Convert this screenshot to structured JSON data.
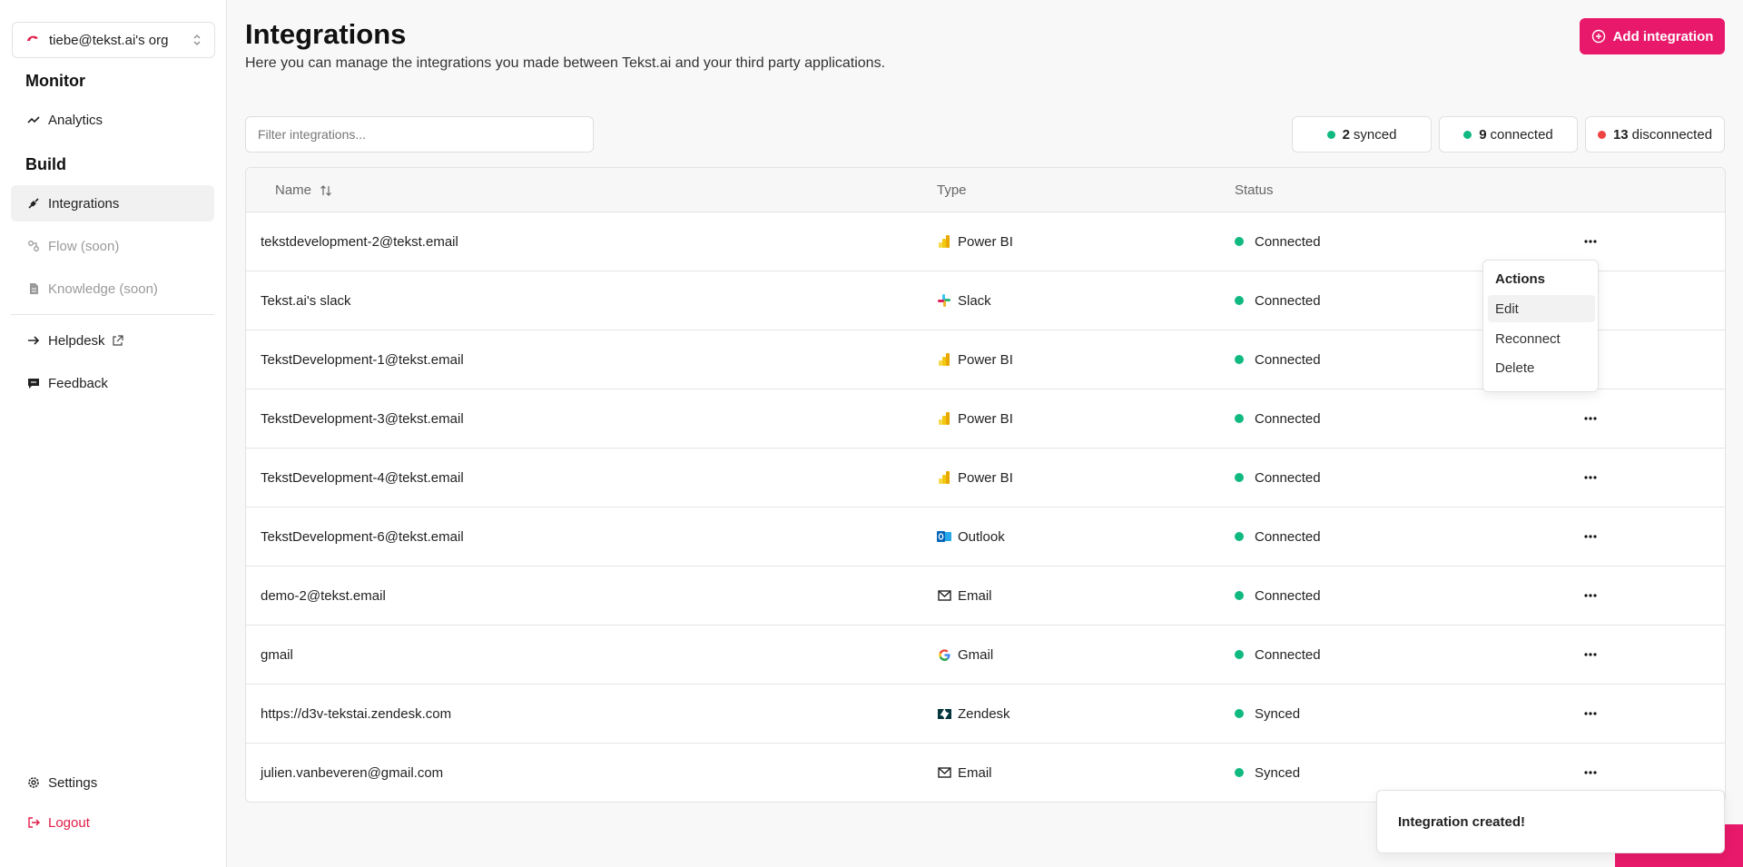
{
  "sidebar": {
    "org_label": "tiebe@tekst.ai's org",
    "sections": {
      "monitor": "Monitor",
      "build": "Build"
    },
    "items": {
      "analytics": "Analytics",
      "integrations": "Integrations",
      "flow": "Flow (soon)",
      "knowledge": "Knowledge (soon)",
      "helpdesk": "Helpdesk",
      "feedback": "Feedback",
      "settings": "Settings",
      "logout": "Logout"
    }
  },
  "header": {
    "title": "Integrations",
    "subtitle": "Here you can manage the integrations you made between Tekst.ai and your third party applications.",
    "add_label": "Add integration"
  },
  "filter": {
    "placeholder": "Filter integrations..."
  },
  "summary": {
    "synced": {
      "count": "2",
      "label": "synced"
    },
    "connected": {
      "count": "9",
      "label": "connected"
    },
    "disconnected": {
      "count": "13",
      "label": "disconnected"
    }
  },
  "table": {
    "headers": {
      "name": "Name",
      "type": "Type",
      "status": "Status"
    },
    "rows": [
      {
        "name": "tekstdevelopment-2@tekst.email",
        "type": "Power BI",
        "status": "Connected"
      },
      {
        "name": "Tekst.ai's slack",
        "type": "Slack",
        "status": "Connected"
      },
      {
        "name": "TekstDevelopment-1@tekst.email",
        "type": "Power BI",
        "status": "Connected"
      },
      {
        "name": "TekstDevelopment-3@tekst.email",
        "type": "Power BI",
        "status": "Connected"
      },
      {
        "name": "TekstDevelopment-4@tekst.email",
        "type": "Power BI",
        "status": "Connected"
      },
      {
        "name": "TekstDevelopment-6@tekst.email",
        "type": "Outlook",
        "status": "Connected"
      },
      {
        "name": "demo-2@tekst.email",
        "type": "Email",
        "status": "Connected"
      },
      {
        "name": "gmail",
        "type": "Gmail",
        "status": "Connected"
      },
      {
        "name": "https://d3v-tekstai.zendesk.com",
        "type": "Zendesk",
        "status": "Synced"
      },
      {
        "name": "julien.vanbeveren@gmail.com",
        "type": "Email",
        "status": "Synced"
      }
    ]
  },
  "menu": {
    "title": "Actions",
    "items": {
      "edit": "Edit",
      "reconnect": "Reconnect",
      "delete": "Delete"
    }
  },
  "toast": {
    "message": "Integration created!"
  },
  "colors": {
    "brand": "#e8196a",
    "status_green": "#10b981",
    "status_red": "#ef4444",
    "logout_red": "#e11d48"
  }
}
